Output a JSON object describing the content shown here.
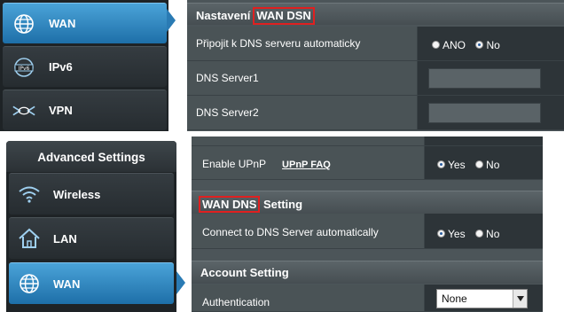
{
  "panel_top": {
    "nav": [
      {
        "label": "WAN",
        "icon": "globe-icon",
        "active": true
      },
      {
        "label": "IPv6",
        "icon": "ipv6-icon",
        "active": false
      },
      {
        "label": "VPN",
        "icon": "vpn-icon",
        "active": false
      }
    ],
    "header": {
      "prefix": "Nastavení",
      "highlight": "WAN DSN"
    },
    "rows": [
      {
        "label": "Připojit k DNS serveru automaticky",
        "options": [
          "ANO",
          "No"
        ],
        "selected": "No"
      },
      {
        "label": "DNS Server1",
        "value": ""
      },
      {
        "label": "DNS Server2",
        "value": ""
      }
    ]
  },
  "panel_bottom": {
    "sidebar_title": "Advanced Settings",
    "nav": [
      {
        "label": "Wireless",
        "icon": "wifi-icon",
        "active": false
      },
      {
        "label": "LAN",
        "icon": "home-icon",
        "active": false
      },
      {
        "label": "WAN",
        "icon": "globe-icon",
        "active": true
      }
    ],
    "upnp": {
      "label": "Enable UPnP",
      "link": "UPnP  FAQ",
      "options": [
        "Yes",
        "No"
      ],
      "selected": "Yes"
    },
    "dns_header": {
      "highlight": "WAN DNS",
      "suffix": " Setting"
    },
    "dns_auto": {
      "label": "Connect to DNS Server automatically",
      "options": [
        "Yes",
        "No"
      ],
      "selected": "Yes"
    },
    "account_header": "Account Setting",
    "auth": {
      "label": "Authentication",
      "value": "None"
    }
  },
  "colors": {
    "accent_red": "#e02020",
    "active_blue": "#2a7bb4",
    "bg_dark": "#1e2326"
  }
}
